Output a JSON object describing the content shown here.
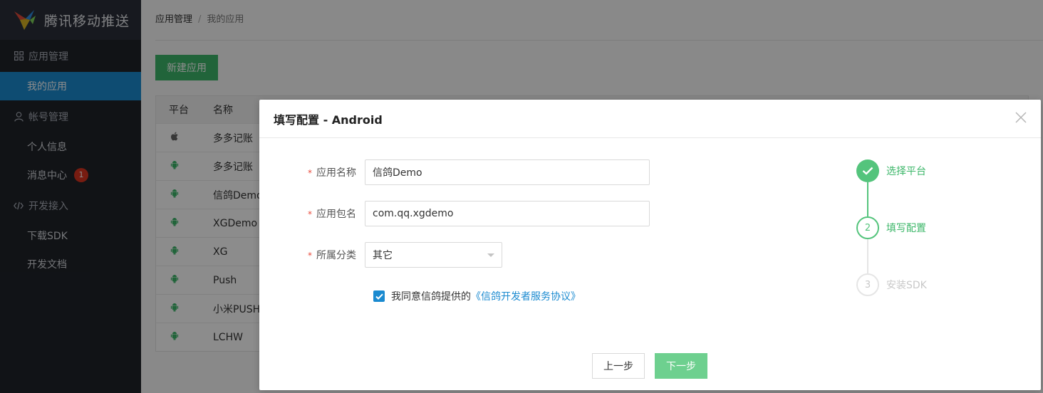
{
  "brand": {
    "name": "腾讯移动推送"
  },
  "sidebar": {
    "groups": [
      {
        "label": "应用管理",
        "icon": "grid-icon",
        "items": [
          {
            "label": "我的应用",
            "active": true
          }
        ]
      },
      {
        "label": "帐号管理",
        "icon": "user-icon",
        "items": [
          {
            "label": "个人信息"
          },
          {
            "label": "消息中心",
            "badge": "1"
          }
        ]
      },
      {
        "label": "开发接入",
        "icon": "code-icon",
        "items": [
          {
            "label": "下载SDK"
          },
          {
            "label": "开发文档"
          }
        ]
      }
    ]
  },
  "breadcrumb": {
    "root": "应用管理",
    "separator": "/",
    "current": "我的应用"
  },
  "toolbar": {
    "new_app_label": "新建应用"
  },
  "table": {
    "headers": {
      "platform": "平台",
      "name": "名称"
    },
    "rows": [
      {
        "platform": "apple",
        "name": "多多记账"
      },
      {
        "platform": "android",
        "name": "多多记账"
      },
      {
        "platform": "android",
        "name": "信鸽Demo"
      },
      {
        "platform": "android",
        "name": "XGDemo"
      },
      {
        "platform": "android",
        "name": "XG"
      },
      {
        "platform": "android",
        "name": "Push"
      },
      {
        "platform": "android",
        "name": "小米PUSH"
      },
      {
        "platform": "android",
        "name": "LCHW"
      }
    ]
  },
  "modal": {
    "title": "填写配置 - Android",
    "form": {
      "app_name": {
        "label": "应用名称",
        "value": "信鸽Demo"
      },
      "package_name": {
        "label": "应用包名",
        "value": "com.qq.xgdemo"
      },
      "category": {
        "label": "所属分类",
        "value": "其它"
      }
    },
    "agreement": {
      "text": "我同意信鸽提供的",
      "link": "《信鸽开发者服务协议》",
      "checked": true
    },
    "buttons": {
      "prev": "上一步",
      "next": "下一步"
    },
    "steps": [
      {
        "number": "1",
        "label": "选择平台",
        "state": "done"
      },
      {
        "number": "2",
        "label": "填写配置",
        "state": "current"
      },
      {
        "number": "3",
        "label": "安装SDK",
        "state": "todo"
      }
    ]
  },
  "colors": {
    "accent_blue": "#1a8ad0",
    "accent_green": "#3db76a",
    "badge_red": "#d9341f",
    "sidebar_bg": "#1f2329"
  }
}
